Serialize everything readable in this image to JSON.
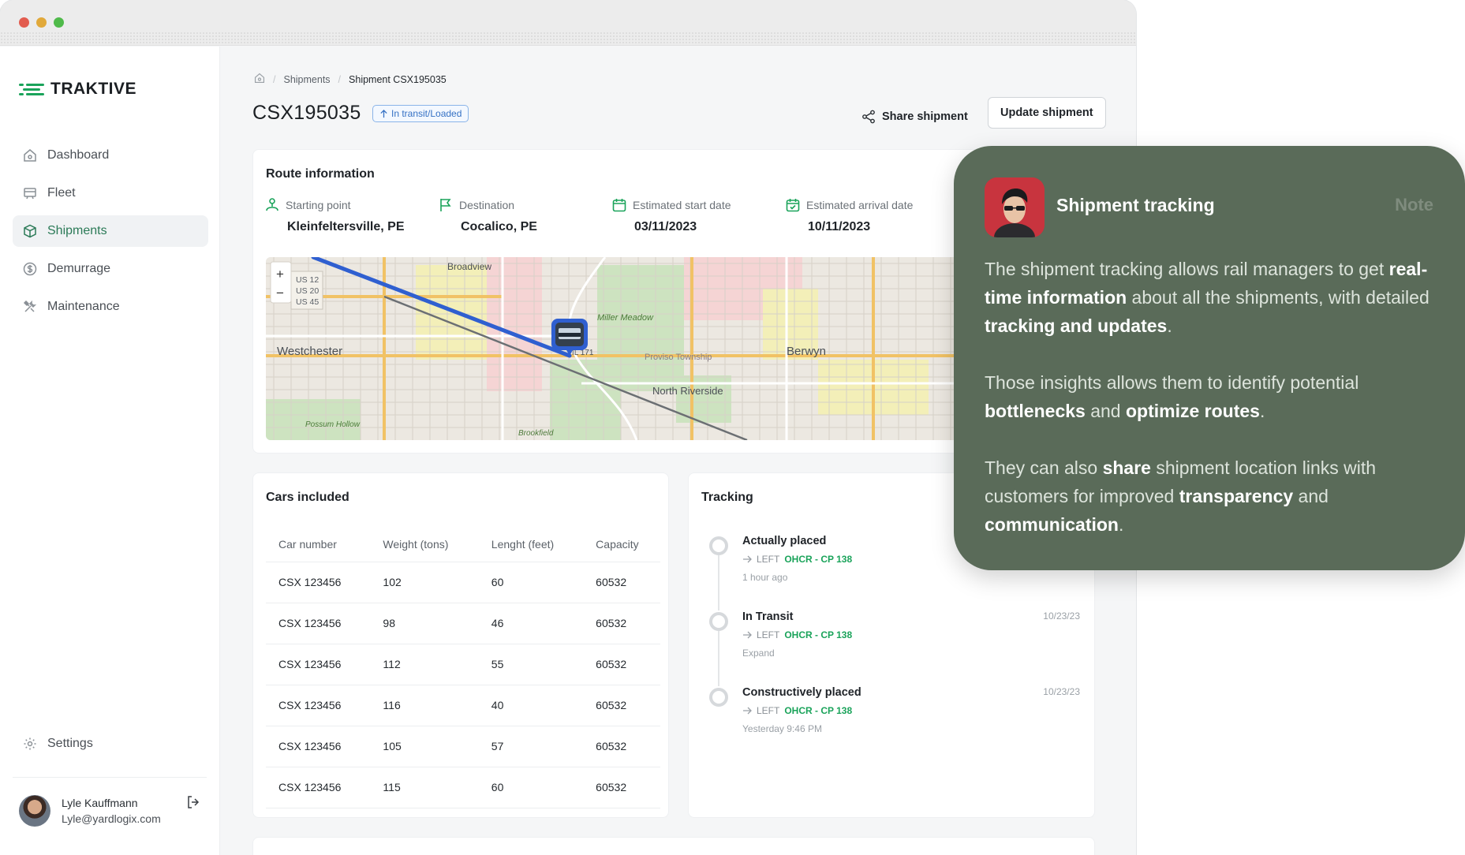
{
  "app": {
    "name": "TRAKTIVE"
  },
  "sidebar": {
    "items": [
      {
        "label": "Dashboard",
        "icon": "home-icon",
        "active": false
      },
      {
        "label": "Fleet",
        "icon": "train-icon",
        "active": false
      },
      {
        "label": "Shipments",
        "icon": "box-icon",
        "active": true
      },
      {
        "label": "Demurrage",
        "icon": "dollar-icon",
        "active": false
      },
      {
        "label": "Maintenance",
        "icon": "tools-icon",
        "active": false
      }
    ],
    "settings_label": "Settings",
    "user": {
      "name": "Lyle Kauffmann",
      "email": "Lyle@yardlogix.com"
    }
  },
  "breadcrumb": {
    "items": [
      "Shipments",
      "Shipment CSX195035"
    ]
  },
  "header": {
    "title": "CSX195035",
    "status_badge": "In transit/Loaded",
    "share_label": "Share shipment",
    "update_label": "Update shipment"
  },
  "route": {
    "title": "Route information",
    "fields": [
      {
        "label": "Starting point",
        "value": "Kleinfeltersville, PE",
        "icon": "route-icon"
      },
      {
        "label": "Destination",
        "value": "Cocalico, PE",
        "icon": "flag-icon"
      },
      {
        "label": "Estimated start date",
        "value": "03/11/2023",
        "icon": "calendar-icon"
      },
      {
        "label": "Estimated arrival date",
        "value": "10/11/2023",
        "icon": "calendar-check-icon"
      }
    ],
    "map_labels": {
      "zoom_in": "+",
      "zoom_out": "−",
      "shields": [
        "US 12",
        "US 20",
        "US 45"
      ],
      "broadview": "Broadview",
      "westchester": "Westchester",
      "miller_meadow": "Miller Meadow",
      "il171": "IL 171",
      "proviso": "Proviso Township",
      "berwyn": "Berwyn",
      "north_riverside": "North Riverside",
      "possum_hollow": "Possum Hollow",
      "brookfield": "Brookfield"
    }
  },
  "cars": {
    "title": "Cars included",
    "columns": [
      "Car number",
      "Weight (tons)",
      "Lenght (feet)",
      "Capacity"
    ],
    "rows": [
      [
        "CSX 123456",
        "102",
        "60",
        "60532"
      ],
      [
        "CSX 123456",
        "98",
        "46",
        "60532"
      ],
      [
        "CSX 123456",
        "112",
        "55",
        "60532"
      ],
      [
        "CSX 123456",
        "116",
        "40",
        "60532"
      ],
      [
        "CSX 123456",
        "105",
        "57",
        "60532"
      ],
      [
        "CSX 123456",
        "115",
        "60",
        "60532"
      ]
    ]
  },
  "tracking": {
    "title": "Tracking",
    "events": [
      {
        "title": "Actually placed",
        "prefix": "LEFT",
        "location": "OHCR - CP 138",
        "time": "1 hour ago",
        "date": ""
      },
      {
        "title": "In Transit",
        "prefix": "LEFT",
        "location": "OHCR - CP 138",
        "time": "Expand",
        "date": "10/23/23"
      },
      {
        "title": "Constructively placed",
        "prefix": "LEFT",
        "location": "OHCR - CP 138",
        "time": "Yesterday 9:46 PM",
        "date": "10/23/23"
      }
    ]
  },
  "note": {
    "title": "Shipment tracking",
    "tag": "Note",
    "p1": [
      "The shipment tracking allows rail managers to get ",
      "real-time information",
      " about all the shipments, with detailed ",
      "tracking and updates",
      "."
    ],
    "p2": [
      "Those insights allows them to identify potential ",
      "bottlenecks",
      " and ",
      "optimize routes",
      "."
    ],
    "p3": [
      "They can also ",
      "share",
      " shipment location links with customers for improved ",
      "transparency",
      " and ",
      "communication",
      "."
    ]
  },
  "colors": {
    "accent_green": "#1aa35a",
    "note_bg": "#5a6b59",
    "route_blue": "#2f5fd0",
    "badge_blue": "#3571c4"
  }
}
